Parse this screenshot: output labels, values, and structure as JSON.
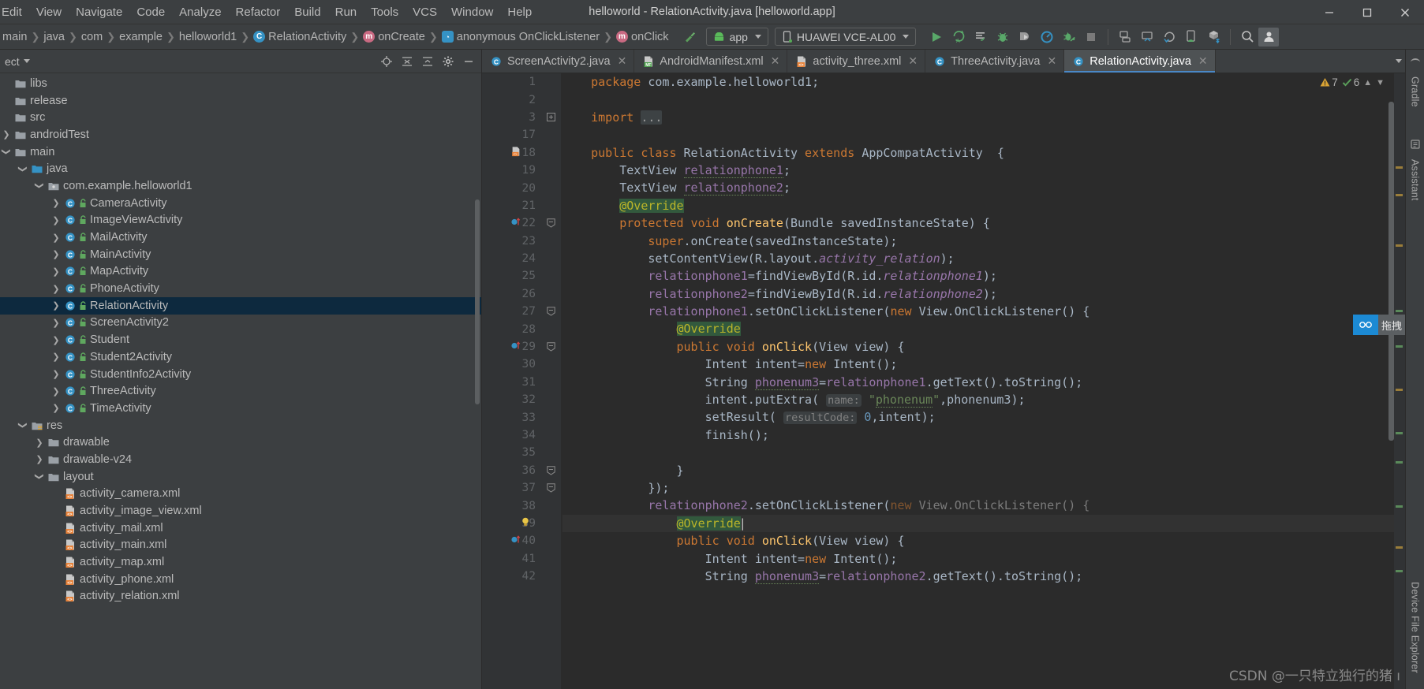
{
  "window": {
    "title": "helloworld - RelationActivity.java [helloworld.app]",
    "minimize": "—",
    "maximize": "☐",
    "close": "✕"
  },
  "menu": [
    {
      "label": "Edit",
      "visible_text": "Edit"
    },
    {
      "label": "View"
    },
    {
      "label": "Navigate"
    },
    {
      "label": "Code"
    },
    {
      "label": "Analyze"
    },
    {
      "label": "Refactor"
    },
    {
      "label": "Build"
    },
    {
      "label": "Run"
    },
    {
      "label": "Tools"
    },
    {
      "label": "VCS"
    },
    {
      "label": "Window"
    },
    {
      "label": "Help"
    }
  ],
  "breadcrumbs": [
    {
      "label": "main",
      "icon": "none"
    },
    {
      "label": "java",
      "icon": "none"
    },
    {
      "label": "com",
      "icon": "none"
    },
    {
      "label": "example",
      "icon": "none"
    },
    {
      "label": "helloworld1",
      "icon": "none"
    },
    {
      "label": "RelationActivity",
      "icon": "class-icon"
    },
    {
      "label": "onCreate",
      "icon": "method-icon"
    },
    {
      "label": "anonymous OnClickListener",
      "icon": "anonymous-class-icon"
    },
    {
      "label": "onClick",
      "icon": "method-icon"
    }
  ],
  "toolbar": {
    "run_config": "app",
    "device": "HUAWEI VCE-AL00",
    "buttons": [
      {
        "name": "run-button",
        "title": "Run"
      },
      {
        "name": "apply-changes-button",
        "title": "Apply Changes and Restart Activity"
      },
      {
        "name": "apply-code-changes-button",
        "title": "Apply Code Changes"
      },
      {
        "name": "debug-button",
        "title": "Debug"
      },
      {
        "name": "attach-debugger-button",
        "title": "Attach Debugger to Android Process"
      },
      {
        "name": "profiler-button",
        "title": "Profile"
      },
      {
        "name": "run-with-coverage-button",
        "title": "Run with Coverage"
      },
      {
        "name": "stop-button",
        "title": "Stop"
      },
      {
        "name": "avd-manager-button",
        "title": "AVD Manager"
      },
      {
        "name": "sdk-manager-button",
        "title": "SDK Manager"
      },
      {
        "name": "gradle-sync-button",
        "title": "Sync Project with Gradle Files"
      },
      {
        "name": "device-manager-button",
        "title": "Device Manager"
      },
      {
        "name": "sdk-download-button",
        "title": "SDK Download"
      },
      {
        "name": "search-everywhere-button",
        "title": "Search Everywhere"
      },
      {
        "name": "account-avatar",
        "title": "Account"
      }
    ]
  },
  "project_panel": {
    "title": "ect",
    "header_icons": [
      "target-icon",
      "collapse-icon",
      "expand-icon",
      "settings-icon",
      "hide-icon"
    ],
    "tree": [
      {
        "label": "libs",
        "depth": 0,
        "arrow": "none",
        "icon": "folder",
        "lock": false
      },
      {
        "label": "release",
        "depth": 0,
        "arrow": "none",
        "icon": "folder",
        "lock": false
      },
      {
        "label": "src",
        "depth": 0,
        "arrow": "none",
        "icon": "folder",
        "lock": false
      },
      {
        "label": "androidTest",
        "depth": 0,
        "arrow": "right",
        "icon": "folder",
        "lock": false
      },
      {
        "label": "main",
        "depth": 0,
        "arrow": "down",
        "icon": "folder",
        "lock": false
      },
      {
        "label": "java",
        "depth": 1,
        "arrow": "down",
        "icon": "folder-source",
        "lock": false
      },
      {
        "label": "com.example.helloworld1",
        "depth": 2,
        "arrow": "down",
        "icon": "package",
        "lock": false
      },
      {
        "label": "CameraActivity",
        "depth": 3,
        "arrow": "right",
        "icon": "class",
        "lock": true
      },
      {
        "label": "ImageViewActivity",
        "depth": 3,
        "arrow": "right",
        "icon": "class",
        "lock": true
      },
      {
        "label": "MailActivity",
        "depth": 3,
        "arrow": "right",
        "icon": "class",
        "lock": true
      },
      {
        "label": "MainActivity",
        "depth": 3,
        "arrow": "right",
        "icon": "class",
        "lock": true
      },
      {
        "label": "MapActivity",
        "depth": 3,
        "arrow": "right",
        "icon": "class",
        "lock": true
      },
      {
        "label": "PhoneActivity",
        "depth": 3,
        "arrow": "right",
        "icon": "class",
        "lock": true
      },
      {
        "label": "RelationActivity",
        "depth": 3,
        "arrow": "right",
        "icon": "class",
        "lock": true,
        "selected": true
      },
      {
        "label": "ScreenActivity2",
        "depth": 3,
        "arrow": "right",
        "icon": "class",
        "lock": true
      },
      {
        "label": "Student",
        "depth": 3,
        "arrow": "right",
        "icon": "class",
        "lock": true
      },
      {
        "label": "Student2Activity",
        "depth": 3,
        "arrow": "right",
        "icon": "class",
        "lock": true
      },
      {
        "label": "StudentInfo2Activity",
        "depth": 3,
        "arrow": "right",
        "icon": "class",
        "lock": true
      },
      {
        "label": "ThreeActivity",
        "depth": 3,
        "arrow": "right",
        "icon": "class",
        "lock": true
      },
      {
        "label": "TimeActivity",
        "depth": 3,
        "arrow": "right",
        "icon": "class",
        "lock": true
      },
      {
        "label": "res",
        "depth": 1,
        "arrow": "down",
        "icon": "folder-res",
        "lock": false
      },
      {
        "label": "drawable",
        "depth": 2,
        "arrow": "right",
        "icon": "folder",
        "lock": false
      },
      {
        "label": "drawable-v24",
        "depth": 2,
        "arrow": "right",
        "icon": "folder",
        "lock": false
      },
      {
        "label": "layout",
        "depth": 2,
        "arrow": "down",
        "icon": "folder",
        "lock": false
      },
      {
        "label": "activity_camera.xml",
        "depth": 3,
        "arrow": "none",
        "icon": "xml",
        "lock": false
      },
      {
        "label": "activity_image_view.xml",
        "depth": 3,
        "arrow": "none",
        "icon": "xml",
        "lock": false
      },
      {
        "label": "activity_mail.xml",
        "depth": 3,
        "arrow": "none",
        "icon": "xml",
        "lock": false
      },
      {
        "label": "activity_main.xml",
        "depth": 3,
        "arrow": "none",
        "icon": "xml",
        "lock": false
      },
      {
        "label": "activity_map.xml",
        "depth": 3,
        "arrow": "none",
        "icon": "xml",
        "lock": false
      },
      {
        "label": "activity_phone.xml",
        "depth": 3,
        "arrow": "none",
        "icon": "xml",
        "lock": false
      },
      {
        "label": "activity_relation.xml",
        "depth": 3,
        "arrow": "none",
        "icon": "xml",
        "lock": false
      }
    ]
  },
  "editor": {
    "tabs": [
      {
        "label": "ScreenActivity2.java",
        "icon": "class",
        "active": false
      },
      {
        "label": "AndroidManifest.xml",
        "icon": "manifest",
        "active": false
      },
      {
        "label": "activity_three.xml",
        "icon": "xml",
        "active": false
      },
      {
        "label": "ThreeActivity.java",
        "icon": "class",
        "active": false
      },
      {
        "label": "RelationActivity.java",
        "icon": "class",
        "active": true
      }
    ],
    "inspections": {
      "warnings": "7",
      "checks": "6"
    },
    "lines": [
      {
        "num": "1",
        "indent": 0,
        "marker": "",
        "fold": "",
        "tokens": [
          {
            "t": "package ",
            "c": "kw"
          },
          {
            "t": "com.example.helloworld1;",
            "c": ""
          }
        ]
      },
      {
        "num": "2",
        "indent": 0,
        "marker": "",
        "fold": "",
        "tokens": []
      },
      {
        "num": "3",
        "indent": 0,
        "marker": "",
        "fold": "plus",
        "tokens": [
          {
            "t": "import ",
            "c": "kw"
          },
          {
            "t": "...",
            "c": "folded"
          }
        ]
      },
      {
        "num": "17",
        "indent": 0,
        "marker": "",
        "fold": "",
        "tokens": []
      },
      {
        "num": "18",
        "indent": 0,
        "marker": "xml-badge",
        "fold": "",
        "tokens": [
          {
            "t": "public class ",
            "c": "kw"
          },
          {
            "t": "RelationActivity",
            "c": ""
          },
          {
            "t": " extends ",
            "c": "kw"
          },
          {
            "t": "AppCompatActivity  {",
            "c": ""
          }
        ]
      },
      {
        "num": "19",
        "indent": 1,
        "marker": "",
        "fold": "",
        "tokens": [
          {
            "t": "TextView ",
            "c": ""
          },
          {
            "t": "relationphone1",
            "c": "fldu"
          },
          {
            "t": ";",
            "c": ""
          }
        ]
      },
      {
        "num": "20",
        "indent": 1,
        "marker": "",
        "fold": "",
        "tokens": [
          {
            "t": "TextView ",
            "c": ""
          },
          {
            "t": "relationphone2",
            "c": "fldu"
          },
          {
            "t": ";",
            "c": ""
          }
        ]
      },
      {
        "num": "21",
        "indent": 1,
        "marker": "",
        "fold": "",
        "tokens": [
          {
            "t": "@Override",
            "c": "annhl"
          }
        ]
      },
      {
        "num": "22",
        "indent": 1,
        "marker": "override-method",
        "fold": "minus",
        "tokens": [
          {
            "t": "protected void ",
            "c": "kw"
          },
          {
            "t": "onCreate",
            "c": "meth"
          },
          {
            "t": "(Bundle savedInstanceState) {",
            "c": ""
          }
        ]
      },
      {
        "num": "23",
        "indent": 2,
        "marker": "",
        "fold": "",
        "tokens": [
          {
            "t": "super",
            "c": "kw"
          },
          {
            "t": ".onCreate(savedInstanceState);",
            "c": ""
          }
        ]
      },
      {
        "num": "24",
        "indent": 2,
        "marker": "",
        "fold": "",
        "tokens": [
          {
            "t": "setContentView(R.layout.",
            "c": ""
          },
          {
            "t": "activity_relation",
            "c": "ital"
          },
          {
            "t": ");",
            "c": ""
          }
        ]
      },
      {
        "num": "25",
        "indent": 2,
        "marker": "",
        "fold": "",
        "tokens": [
          {
            "t": "relationphone1",
            "c": "fld"
          },
          {
            "t": "=findViewById(R.id.",
            "c": ""
          },
          {
            "t": "relationphone1",
            "c": "ital"
          },
          {
            "t": ");",
            "c": ""
          }
        ]
      },
      {
        "num": "26",
        "indent": 2,
        "marker": "",
        "fold": "",
        "tokens": [
          {
            "t": "relationphone2",
            "c": "fld"
          },
          {
            "t": "=findViewById(R.id.",
            "c": ""
          },
          {
            "t": "relationphone2",
            "c": "ital"
          },
          {
            "t": ");",
            "c": ""
          }
        ]
      },
      {
        "num": "27",
        "indent": 2,
        "marker": "",
        "fold": "minus",
        "tokens": [
          {
            "t": "relationphone1",
            "c": "fld"
          },
          {
            "t": ".setOnClickListener(",
            "c": ""
          },
          {
            "t": "new ",
            "c": "kw"
          },
          {
            "t": "View.OnClickListener() {",
            "c": ""
          }
        ]
      },
      {
        "num": "28",
        "indent": 3,
        "marker": "",
        "fold": "",
        "tokens": [
          {
            "t": "@Override",
            "c": "annhl"
          }
        ]
      },
      {
        "num": "29",
        "indent": 3,
        "marker": "override-method",
        "fold": "minus",
        "tokens": [
          {
            "t": "public void ",
            "c": "kw"
          },
          {
            "t": "onClick",
            "c": "meth"
          },
          {
            "t": "(View view) {",
            "c": ""
          }
        ]
      },
      {
        "num": "30",
        "indent": 4,
        "marker": "",
        "fold": "",
        "tokens": [
          {
            "t": "Intent intent=",
            "c": ""
          },
          {
            "t": "new ",
            "c": "kw"
          },
          {
            "t": "Intent();",
            "c": ""
          }
        ]
      },
      {
        "num": "31",
        "indent": 4,
        "marker": "",
        "fold": "",
        "tokens": [
          {
            "t": "String ",
            "c": ""
          },
          {
            "t": "phonenum3",
            "c": "fldu"
          },
          {
            "t": "=",
            "c": ""
          },
          {
            "t": "relationphone1",
            "c": "fld"
          },
          {
            "t": ".getText().toString();",
            "c": ""
          }
        ]
      },
      {
        "num": "32",
        "indent": 4,
        "marker": "",
        "fold": "",
        "tokens": [
          {
            "t": "intent.putExtra( ",
            "c": ""
          },
          {
            "t": "name:",
            "c": "hint"
          },
          {
            "t": " ",
            "c": ""
          },
          {
            "t": "\"",
            "c": "str"
          },
          {
            "t": "phonenum",
            "c": "stru"
          },
          {
            "t": "\"",
            "c": "str"
          },
          {
            "t": ",phonenum3);",
            "c": ""
          }
        ]
      },
      {
        "num": "33",
        "indent": 4,
        "marker": "",
        "fold": "",
        "tokens": [
          {
            "t": "setResult( ",
            "c": ""
          },
          {
            "t": "resultCode:",
            "c": "hint"
          },
          {
            "t": " ",
            "c": ""
          },
          {
            "t": "0",
            "c": "num"
          },
          {
            "t": ",intent);",
            "c": ""
          }
        ]
      },
      {
        "num": "34",
        "indent": 4,
        "marker": "",
        "fold": "",
        "tokens": [
          {
            "t": "finish();",
            "c": ""
          }
        ]
      },
      {
        "num": "35",
        "indent": 0,
        "marker": "",
        "fold": "",
        "tokens": []
      },
      {
        "num": "36",
        "indent": 3,
        "marker": "",
        "fold": "minus",
        "tokens": [
          {
            "t": "}",
            "c": ""
          }
        ]
      },
      {
        "num": "37",
        "indent": 2,
        "marker": "",
        "fold": "minus",
        "tokens": [
          {
            "t": "});",
            "c": ""
          }
        ]
      },
      {
        "num": "38",
        "indent": 2,
        "marker": "",
        "fold": "",
        "tokens": [
          {
            "t": "relationphone2",
            "c": "fld"
          },
          {
            "t": ".setOnClickListener(",
            "c": ""
          },
          {
            "t": "new ",
            "c": "kwg"
          },
          {
            "t": "View.OnClickListener() {",
            "c": "grey"
          }
        ]
      },
      {
        "num": "39",
        "indent": 3,
        "marker": "bulb",
        "fold": "",
        "tokens": [
          {
            "t": "@Override",
            "c": "annhl"
          },
          {
            "t": "|",
            "c": "caret"
          }
        ],
        "current": true
      },
      {
        "num": "40",
        "indent": 3,
        "marker": "override-method",
        "fold": "",
        "tokens": [
          {
            "t": "public void ",
            "c": "kw"
          },
          {
            "t": "onClick",
            "c": "meth"
          },
          {
            "t": "(View view) {",
            "c": ""
          }
        ]
      },
      {
        "num": "41",
        "indent": 4,
        "marker": "",
        "fold": "",
        "tokens": [
          {
            "t": "Intent intent=",
            "c": ""
          },
          {
            "t": "new ",
            "c": "kw"
          },
          {
            "t": "Intent();",
            "c": ""
          }
        ]
      },
      {
        "num": "42",
        "indent": 4,
        "marker": "",
        "fold": "",
        "tokens": [
          {
            "t": "String ",
            "c": ""
          },
          {
            "t": "phonenum3",
            "c": "fldu"
          },
          {
            "t": "=",
            "c": ""
          },
          {
            "t": "relationphone2",
            "c": "fld"
          },
          {
            "t": ".getText().toString();",
            "c": ""
          }
        ]
      }
    ]
  },
  "right_strip": {
    "tabs": [
      "Gradle",
      "Assistant",
      "Device File Explorer"
    ]
  },
  "float_widget": {
    "label": "拖拽"
  },
  "watermark": "CSDN @一只特立独行的猪 ı",
  "colors": {
    "bg": "#3c3f41",
    "editor_bg": "#2b2b2b",
    "gutter_bg": "#313335",
    "selection": "#0d293e",
    "accent": "#4a88c7",
    "keyword": "#cc7832",
    "method": "#ffc66d",
    "field": "#9876aa",
    "string": "#6a8759",
    "number": "#6897bb",
    "annotation": "#bbb529"
  }
}
